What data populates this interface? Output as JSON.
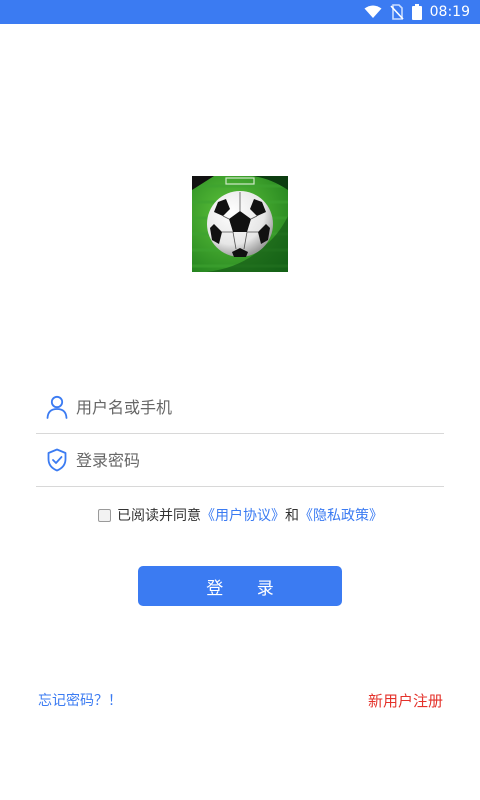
{
  "status_bar": {
    "time": "08:19",
    "bg_color": "#3b7bf2",
    "icons": [
      "wifi-icon",
      "no-sim-icon",
      "battery-icon"
    ]
  },
  "logo": {
    "icon": "soccer-ball-icon"
  },
  "form": {
    "username": {
      "placeholder": "用户名或手机",
      "value": "",
      "icon": "user-icon"
    },
    "password": {
      "placeholder": "登录密码",
      "value": "",
      "icon": "shield-check-icon"
    }
  },
  "agreement": {
    "checked": false,
    "prefix": "已阅读并同意",
    "user_agreement": "《用户协议》",
    "and": "和",
    "privacy_policy": "《隐私政策》"
  },
  "login_button": {
    "label": "登 录"
  },
  "footer": {
    "forgot_password": "忘记密码？！",
    "register": "新用户注册"
  },
  "colors": {
    "accent": "#3b7bf2",
    "danger": "#e4322b"
  }
}
